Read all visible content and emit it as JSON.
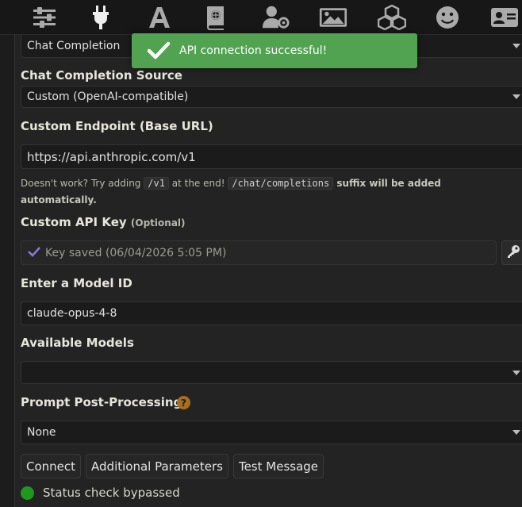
{
  "toast": {
    "message": "API connection successful!"
  },
  "api_type": {
    "selected": "Chat Completion"
  },
  "source": {
    "label": "Chat Completion Source",
    "selected": "Custom (OpenAI-compatible)"
  },
  "endpoint": {
    "label": "Custom Endpoint (Base URL)",
    "value": "https://api.anthropic.com/v1",
    "hint_part1": "Doesn't work? Try adding ",
    "hint_code1": "/v1",
    "hint_part2": " at the end! ",
    "hint_code2": "/chat/completions",
    "hint_bold": " suffix will be added automatically."
  },
  "api_key": {
    "label": "Custom API Key",
    "optional": "(Optional)",
    "saved_text": "Key saved (06/04/2026 5:05 PM)"
  },
  "model_id": {
    "label": "Enter a Model ID",
    "value": "claude-opus-4-8"
  },
  "available_models": {
    "label": "Available Models",
    "selected": ""
  },
  "post_processing": {
    "label": "Prompt Post-Processing",
    "help": "?",
    "selected": "None"
  },
  "buttons": {
    "connect": "Connect",
    "additional": "Additional Parameters",
    "test": "Test Message"
  },
  "status": {
    "text": "Status check bypassed",
    "color": "#1d9a1d"
  },
  "topbar_icons": [
    "sliders-icon",
    "plug-icon",
    "font-icon",
    "book-globe-icon",
    "user-gear-icon",
    "image-icon",
    "cubes-icon",
    "smiley-icon",
    "id-card-icon"
  ]
}
